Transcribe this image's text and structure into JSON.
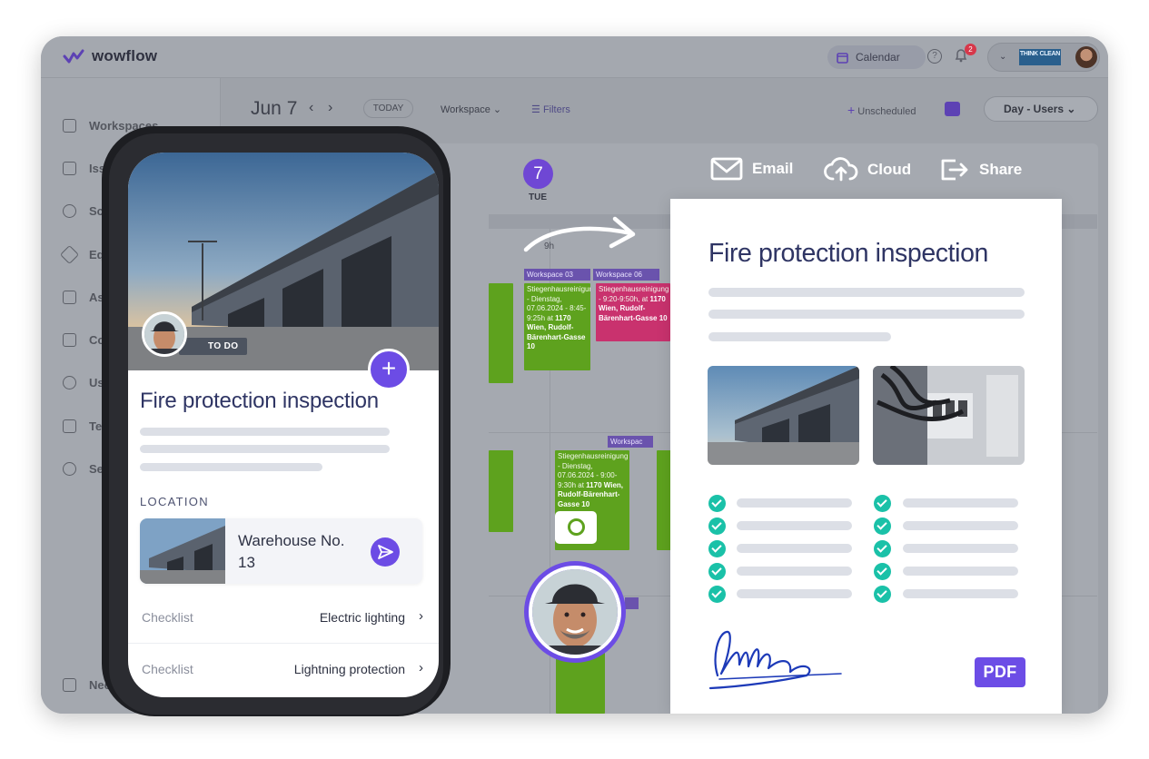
{
  "app": {
    "name": "wowflow"
  },
  "topbar": {
    "calendar_label": "Calendar",
    "help_icon": "help-icon",
    "notification_count": "2",
    "brand_logo_text": "THINK CLEAN"
  },
  "sidebar": {
    "items": [
      {
        "label": "Workspaces",
        "icon": "workspaces-icon"
      },
      {
        "label": "Issues",
        "icon": "issues-icon"
      },
      {
        "label": "Scheduling",
        "icon": "scheduling-icon"
      },
      {
        "label": "Equipment",
        "icon": "equipment-icon"
      },
      {
        "label": "Assets",
        "icon": "assets-icon"
      },
      {
        "label": "Collaborators",
        "icon": "collaborators-icon"
      },
      {
        "label": "Users",
        "icon": "users-icon"
      },
      {
        "label": "Templates",
        "icon": "templates-icon"
      },
      {
        "label": "Settings",
        "icon": "settings-icon"
      }
    ],
    "help_label": "Need help?"
  },
  "calendar": {
    "date": "Jun 7",
    "today_label": "TODAY",
    "workspace_label": "Workspace",
    "filters_label": "Filters",
    "unscheduled_label": "Unscheduled",
    "view_label": "Day - Users",
    "day_number": "7",
    "day_name": "TUE",
    "hour_label": "9h",
    "workspace_tags": [
      "Workspace 03",
      "Workspace 06",
      "Workspac"
    ],
    "events": [
      {
        "text": "Stiegenhausreinigung - Dienstag, 07.06.2024 - 8:45-9:25h at",
        "address": "1170 Wien, Rudolf-Bärenhart-Gasse 10"
      },
      {
        "text": "Stiegenhausreinigung - 9:20-9:50h, at",
        "address": "1170 Wien, Rudolf-Bärenhart-Gasse 10"
      },
      {
        "text": "Stiegenhausreinigung - Dienstag, 07.06.2024 - 9:00-9:30h at",
        "address": "1170 Wien, Rudolf-Bärenhart-Gasse 10"
      }
    ]
  },
  "share": {
    "email_label": "Email",
    "cloud_label": "Cloud",
    "share_label": "Share"
  },
  "document": {
    "title": "Fire protection inspection",
    "pdf_label": "PDF"
  },
  "phone": {
    "status_chip": "TO DO",
    "title": "Fire protection inspection",
    "location_label": "LOCATION",
    "location_name": "Warehouse No. 13",
    "checklists": [
      {
        "label": "Checklist",
        "value": "Electric lighting"
      },
      {
        "label": "Checklist",
        "value": "Lightning protection"
      }
    ]
  },
  "colors": {
    "accent": "#6c4ce5",
    "event_green": "#5ea21e",
    "event_red": "#c9326e",
    "check_teal": "#1ac1a8",
    "title_navy": "#2f3564"
  }
}
